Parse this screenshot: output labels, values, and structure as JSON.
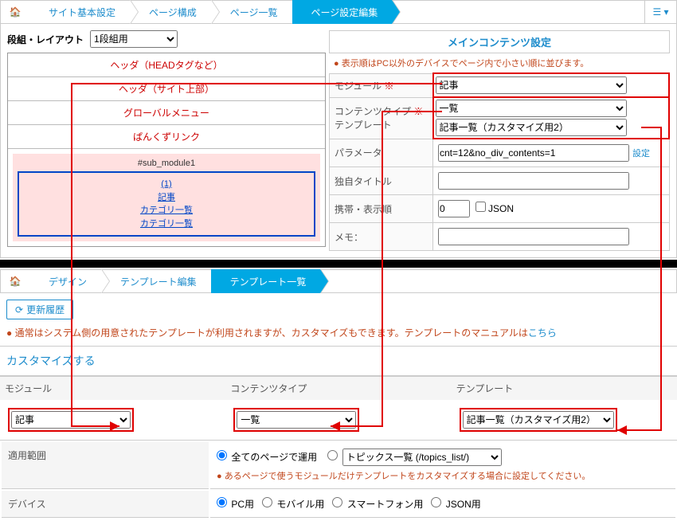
{
  "top": {
    "breadcrumbs": {
      "items": [
        "サイト基本設定",
        "ページ構成",
        "ページ一覧",
        "ページ設定編集"
      ]
    },
    "section_layout_label": "段組・レイアウト",
    "section_layout_value": "1段組用",
    "preview": {
      "rows": [
        "ヘッダ（HEADタグなど）",
        "ヘッダ（サイト上部）",
        "グローバルメニュー",
        "ぱんくずリンク"
      ],
      "sub_title": "#sub_module1",
      "blue_items": [
        "(1)",
        "記事",
        "カテゴリ一覧",
        "カテゴリ一覧"
      ]
    },
    "right": {
      "title": "メインコンテンツ設定",
      "note": "表示順はPC以外のデバイスでページ内で小さい順に並びます。",
      "module_label": "モジュール",
      "module_value": "記事",
      "ctype_label": "コンテンツタイプ",
      "ctype_value": "一覧",
      "template_label": "テンプレート",
      "template_value": "記事一覧（カスタマイズ用2）",
      "param_label": "パラメータ",
      "param_value": "cnt=12&no_div_contents=1",
      "param_set": "設定",
      "owntitle_label": "独自タイトル",
      "order_label": "携帯・表示順",
      "order_value": "0",
      "json_label": "JSON",
      "memo_label": "メモ："
    }
  },
  "bottom": {
    "breadcrumbs": {
      "items": [
        "デザイン",
        "テンプレート編集",
        "テンプレート一覧"
      ]
    },
    "history_btn": "更新履歴",
    "desc_pre": "通常はシステム側の用意されたテンプレートが利用されますが、カスタマイズもできます。テンプレートのマニュアルは",
    "desc_link": "こちら",
    "customize_title": "カスタマイズする",
    "filters": {
      "module_label": "モジュール",
      "module_value": "記事",
      "ctype_label": "コンテンツタイプ",
      "ctype_value": "一覧",
      "template_label": "テンプレート",
      "template_value": "記事一覧（カスタマイズ用2）"
    },
    "apply": {
      "scope_label": "適用範囲",
      "scope_all": "全てのページで運用",
      "scope_select_value": "トピックス一覧 (/topics_list/)",
      "scope_note": "あるページで使うモジュールだけテンプレートをカスタマイズする場合に設定してください。",
      "device_label": "デバイス",
      "device_pc": "PC用",
      "device_mb": "モバイル用",
      "device_sp": "スマートフォン用",
      "device_json": "JSON用"
    }
  }
}
